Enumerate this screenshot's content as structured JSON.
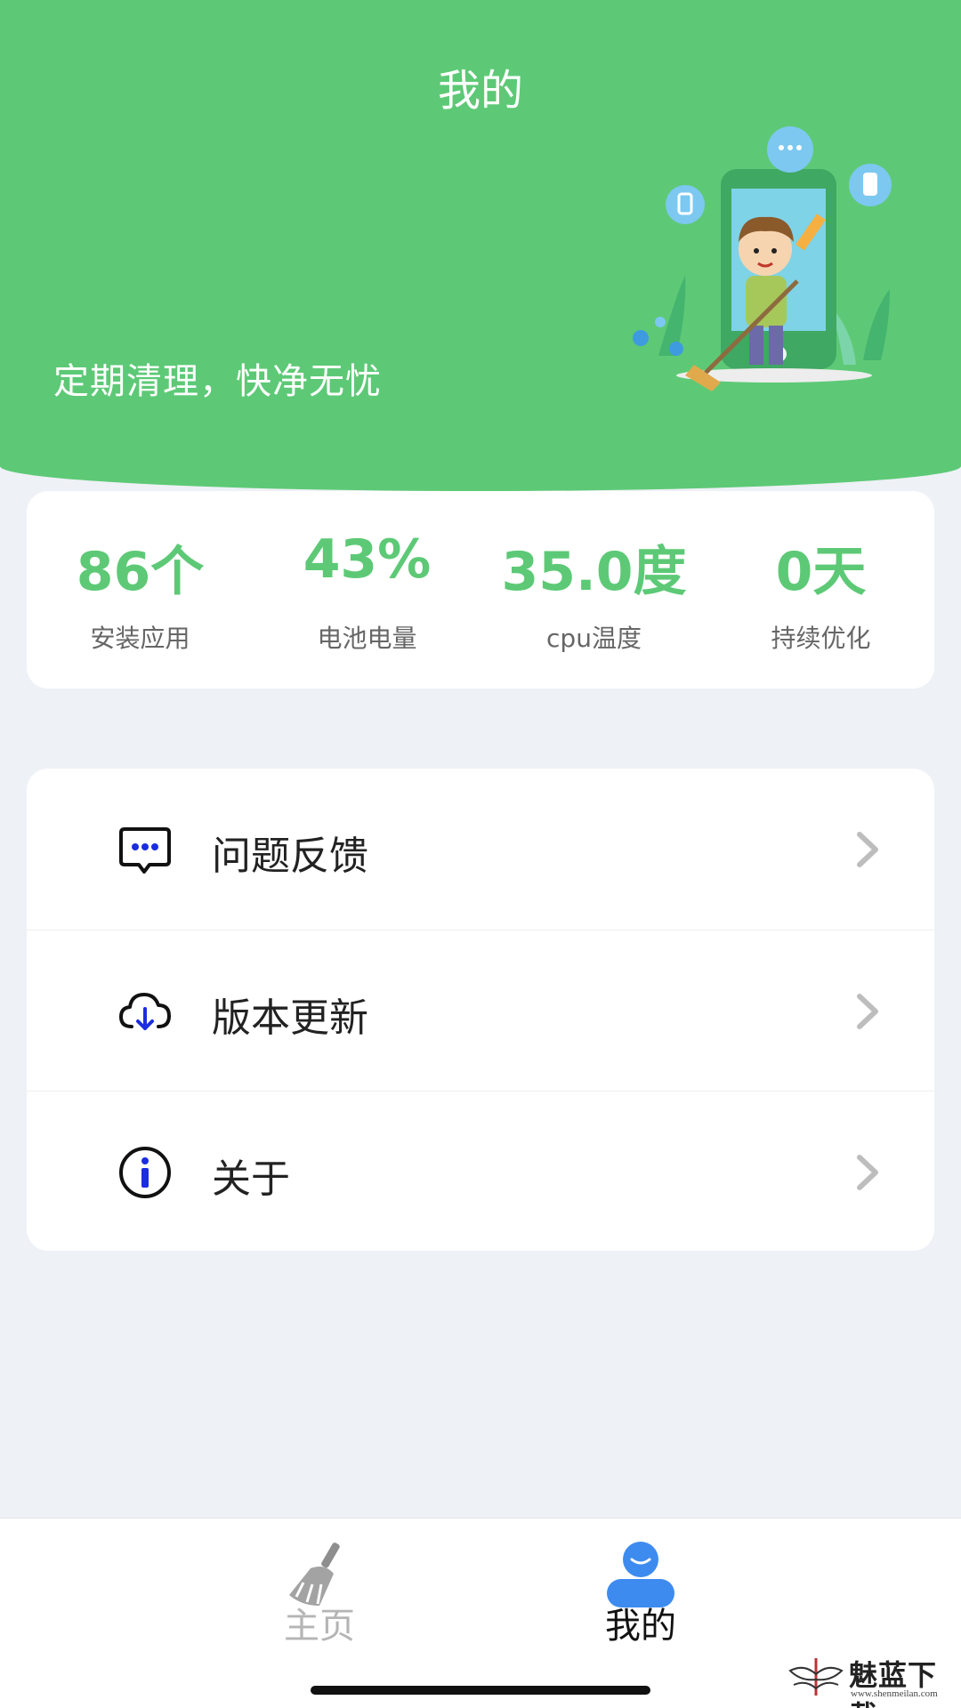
{
  "header": {
    "title": "我的",
    "slogan": "定期清理，快净无忧"
  },
  "stats": [
    {
      "value": "86个",
      "label": "安装应用"
    },
    {
      "value": "43%",
      "label": "电池电量"
    },
    {
      "value": "35.0度",
      "label": "cpu温度"
    },
    {
      "value": "0天",
      "label": "持续优化"
    }
  ],
  "menu": [
    {
      "label": "问题反馈",
      "icon": "chat-bubble-icon"
    },
    {
      "label": "版本更新",
      "icon": "cloud-download-icon"
    },
    {
      "label": "关于",
      "icon": "info-icon"
    }
  ],
  "tabbar": {
    "home_label": "主页",
    "mine_label": "我的"
  },
  "watermark": {
    "text": "魅蓝下载",
    "sub": "www.shenmeilan.com"
  },
  "colors": {
    "primary": "#5DC976",
    "accent_blue": "#1B2DE0",
    "tab_active_blue": "#3E8BF0",
    "tab_inactive": "#B5B5B5"
  }
}
